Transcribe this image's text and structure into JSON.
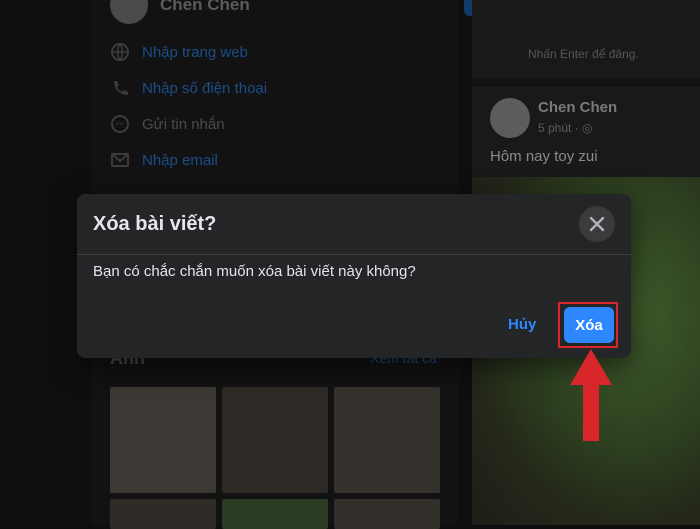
{
  "profile": {
    "name": "Chen Chen"
  },
  "intro": {
    "items": [
      {
        "icon": "globe-icon",
        "label": "Nhập trang web"
      },
      {
        "icon": "phone-icon",
        "label": "Nhập số điện thoại"
      },
      {
        "icon": "messenger-icon",
        "label": "Gửi tin nhắn"
      },
      {
        "icon": "mail-icon",
        "label": "Nhập email"
      }
    ]
  },
  "photos": {
    "title": "Ảnh",
    "see_all": "Xem tất cả"
  },
  "feed": {
    "comment_hint": "Nhấn Enter để đăng.",
    "post": {
      "author": "Chen Chen",
      "time": "5 phút · ",
      "text": "Hôm nay toy zui"
    }
  },
  "dialog": {
    "title": "Xóa bài viết?",
    "message": "Bạn có chắc chắn muốn xóa bài viết này không?",
    "cancel_label": "Hủy",
    "confirm_label": "Xóa"
  },
  "colors": {
    "accent": "#2d88ff",
    "highlight": "#d8262b",
    "dialog_bg": "#242526",
    "text": "#e4e6eb"
  }
}
